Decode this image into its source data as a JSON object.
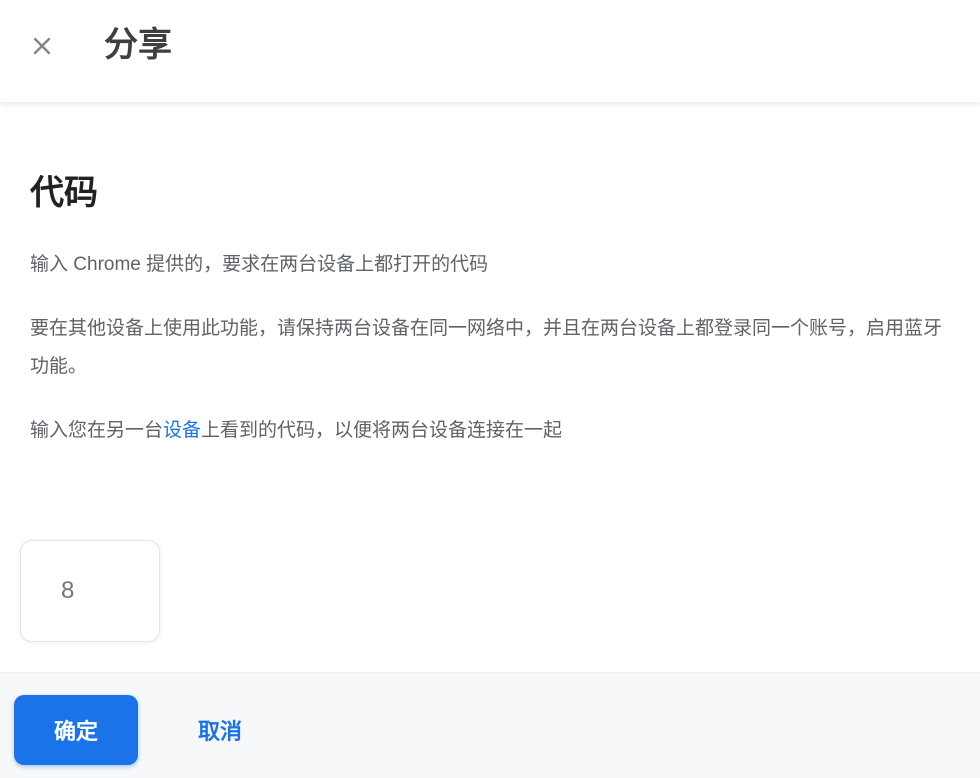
{
  "header": {
    "close_icon": "close-icon",
    "title": "分享"
  },
  "main": {
    "heading": "代码",
    "para1": "输入 Chrome 提供的，要求在两台设备上都打开的代码",
    "para2": "要在其他设备上使用此功能，请保持两台设备在同一网络中，并且在两台设备上都登录同一个账号，启用蓝牙功能。",
    "para3_before": "输入您在另一台",
    "para3_link": "设备",
    "para3_after": "上看到的代码，以便将两台设备连接在一起",
    "code_placeholder": "8"
  },
  "footer": {
    "primary_label": "确定",
    "secondary_label": "取消"
  },
  "colors": {
    "accent": "#1a73e8",
    "text_primary": "#202124",
    "text_secondary": "#5f6368"
  }
}
